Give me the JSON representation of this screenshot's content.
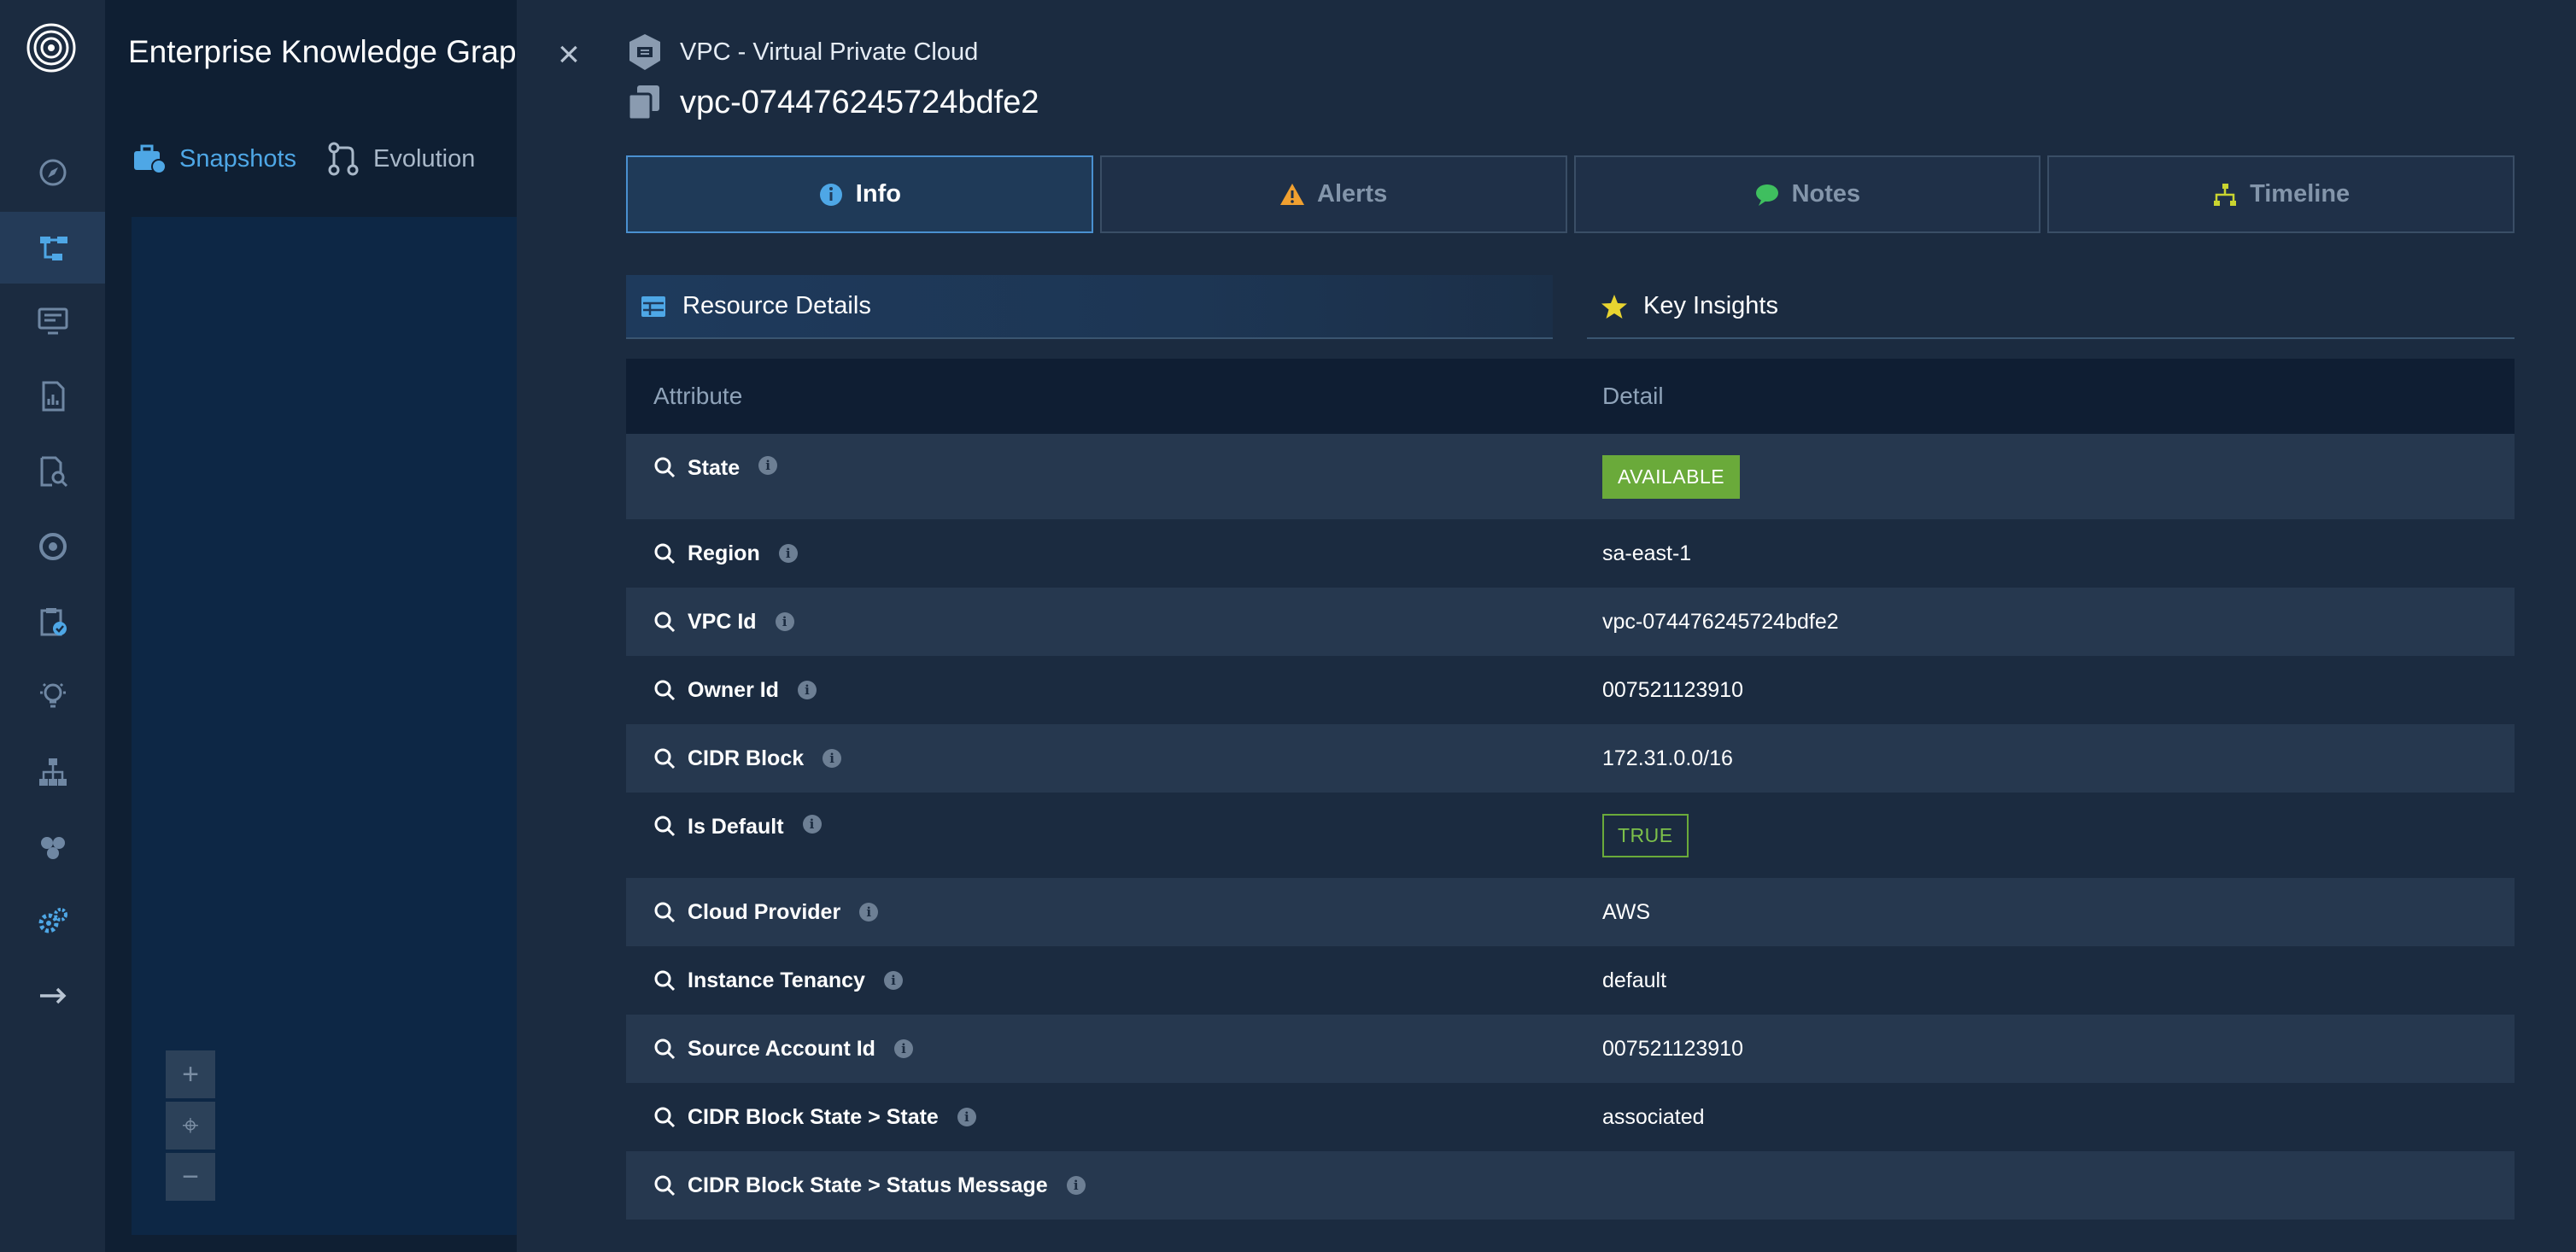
{
  "app": {
    "title": "Enterprise Knowledge Graph"
  },
  "top_tabs": [
    {
      "label": "Snapshots",
      "icon": "briefcase-icon",
      "active": true
    },
    {
      "label": "Evolution",
      "icon": "branch-icon",
      "active": false
    }
  ],
  "zoom": {
    "in": "+",
    "center": "⌖",
    "out": "−"
  },
  "drawer": {
    "close": "×",
    "resource_type": "VPC - Virtual Private Cloud",
    "resource_id": "vpc-074476245724bdfe2",
    "tabs": [
      {
        "label": "Info",
        "icon": "info-icon",
        "active": true
      },
      {
        "label": "Alerts",
        "icon": "warning-icon",
        "active": false
      },
      {
        "label": "Notes",
        "icon": "chat-icon",
        "active": false
      },
      {
        "label": "Timeline",
        "icon": "timeline-icon",
        "active": false
      }
    ],
    "sections": {
      "left": "Resource Details",
      "right": "Key Insights"
    },
    "table": {
      "headers": {
        "attribute": "Attribute",
        "detail": "Detail"
      },
      "rows": [
        {
          "attribute": "State",
          "detail": "AVAILABLE"
        },
        {
          "attribute": "Region",
          "detail": "sa-east-1"
        },
        {
          "attribute": "VPC Id",
          "detail": "vpc-074476245724bdfe2"
        },
        {
          "attribute": "Owner Id",
          "detail": "007521123910"
        },
        {
          "attribute": "CIDR Block",
          "detail": "172.31.0.0/16"
        },
        {
          "attribute": "Is Default",
          "detail": "TRUE"
        },
        {
          "attribute": "Cloud Provider",
          "detail": "AWS"
        },
        {
          "attribute": "Instance Tenancy",
          "detail": "default"
        },
        {
          "attribute": "Source Account Id",
          "detail": "007521123910"
        },
        {
          "attribute": "CIDR Block State > State",
          "detail": "associated"
        },
        {
          "attribute": "CIDR Block State > Status Message",
          "detail": ""
        }
      ]
    }
  },
  "colors": {
    "accent": "#4ea7e6",
    "background": "#1b2b40",
    "success": "#6aaa3a",
    "warning": "#f0a030",
    "insight": "#e8d430"
  }
}
